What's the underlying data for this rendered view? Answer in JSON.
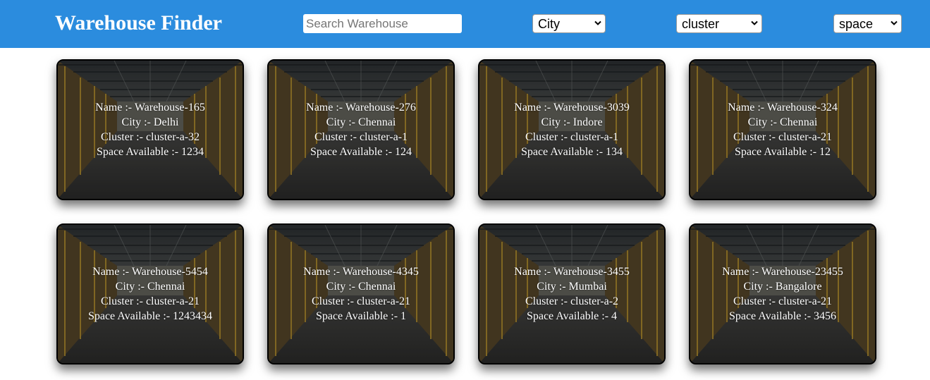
{
  "header": {
    "title": "Warehouse Finder",
    "search_placeholder": "Search Warehouse",
    "filters": {
      "city": "City",
      "cluster": "cluster",
      "space": "space"
    }
  },
  "labels": {
    "name": "Name :- ",
    "city": "City :- ",
    "cluster": "Cluster :- ",
    "space": "Space Available :- "
  },
  "warehouses": [
    {
      "name": "Warehouse-165",
      "city": "Delhi",
      "cluster": "cluster-a-32",
      "space": "1234"
    },
    {
      "name": "Warehouse-276",
      "city": "Chennai",
      "cluster": "cluster-a-1",
      "space": "124"
    },
    {
      "name": "Warehouse-3039",
      "city": "Indore",
      "cluster": "cluster-a-1",
      "space": "134"
    },
    {
      "name": "Warehouse-324",
      "city": "Chennai",
      "cluster": "cluster-a-21",
      "space": "12"
    },
    {
      "name": "Warehouse-5454",
      "city": "Chennai",
      "cluster": "cluster-a-21",
      "space": "1243434"
    },
    {
      "name": "Warehouse-4345",
      "city": "Chennai",
      "cluster": "cluster-a-21",
      "space": "1"
    },
    {
      "name": "Warehouse-3455",
      "city": "Mumbai",
      "cluster": "cluster-a-2",
      "space": "4"
    },
    {
      "name": "Warehouse-23455",
      "city": "Bangalore",
      "cluster": "cluster-a-21",
      "space": "3456"
    }
  ],
  "colors": {
    "header_bg": "#2b8cde",
    "card_border": "#000000",
    "card_text": "#ffffff"
  },
  "card_image": "warehouse-interior-photo"
}
